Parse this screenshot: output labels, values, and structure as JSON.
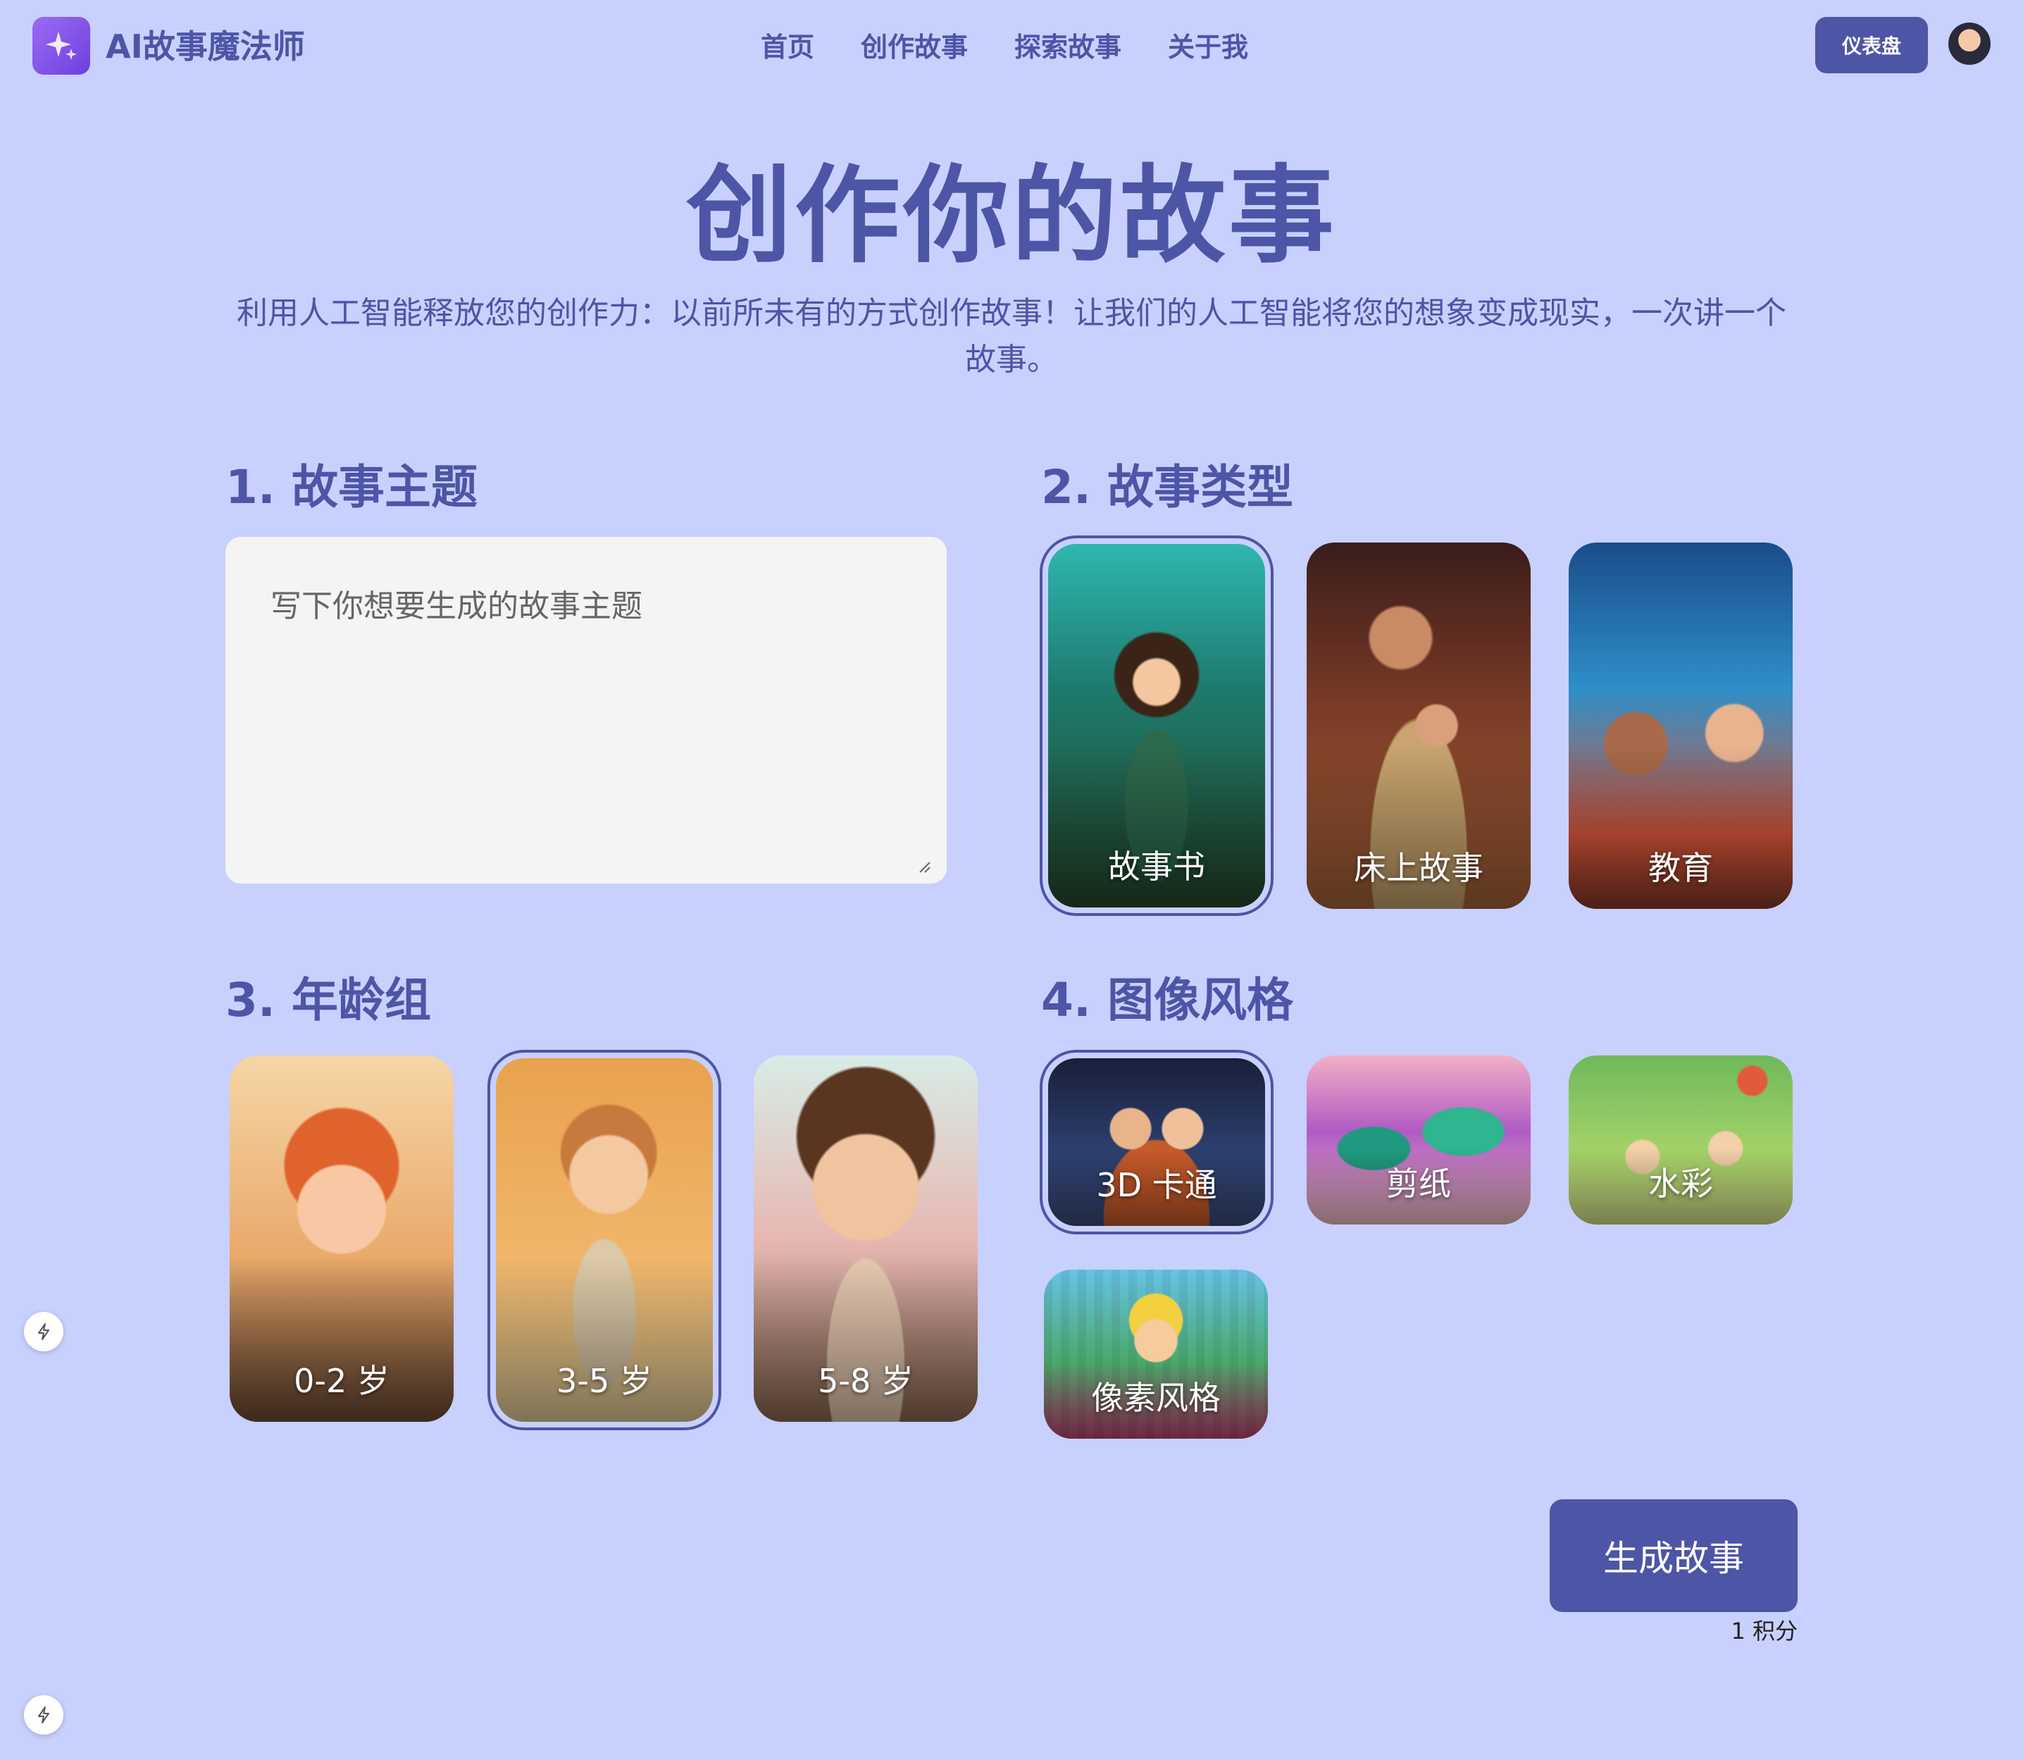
{
  "header": {
    "brand": "AI故事魔法师",
    "nav": [
      "首页",
      "创作故事",
      "探索故事",
      "关于我"
    ],
    "dashboard_label": "仪表盘"
  },
  "hero": {
    "title": "创作你的故事",
    "subtitle": "利用人工智能释放您的创作力：以前所未有的方式创作故事！让我们的人工智能将您的想象变成现实，一次讲一个故事。"
  },
  "topic": {
    "heading": "1. 故事主题",
    "placeholder": "写下你想要生成的故事主题"
  },
  "story_type": {
    "heading": "2. 故事类型",
    "options": [
      "故事书",
      "床上故事",
      "教育"
    ],
    "selected": "故事书"
  },
  "age_group": {
    "heading": "3. 年龄组",
    "options": [
      "0-2 岁",
      "3-5 岁",
      "5-8 岁"
    ],
    "selected": "3-5 岁"
  },
  "image_style": {
    "heading": "4. 图像风格",
    "options": [
      "3D 卡通",
      "剪纸",
      "水彩",
      "像素风格"
    ],
    "selected": "3D 卡通"
  },
  "generate": {
    "label": "生成故事",
    "cost": "1 积分"
  },
  "colors": {
    "background": "#c8d0fe",
    "primary": "#4d55a6",
    "logo": "#7c4dea"
  }
}
